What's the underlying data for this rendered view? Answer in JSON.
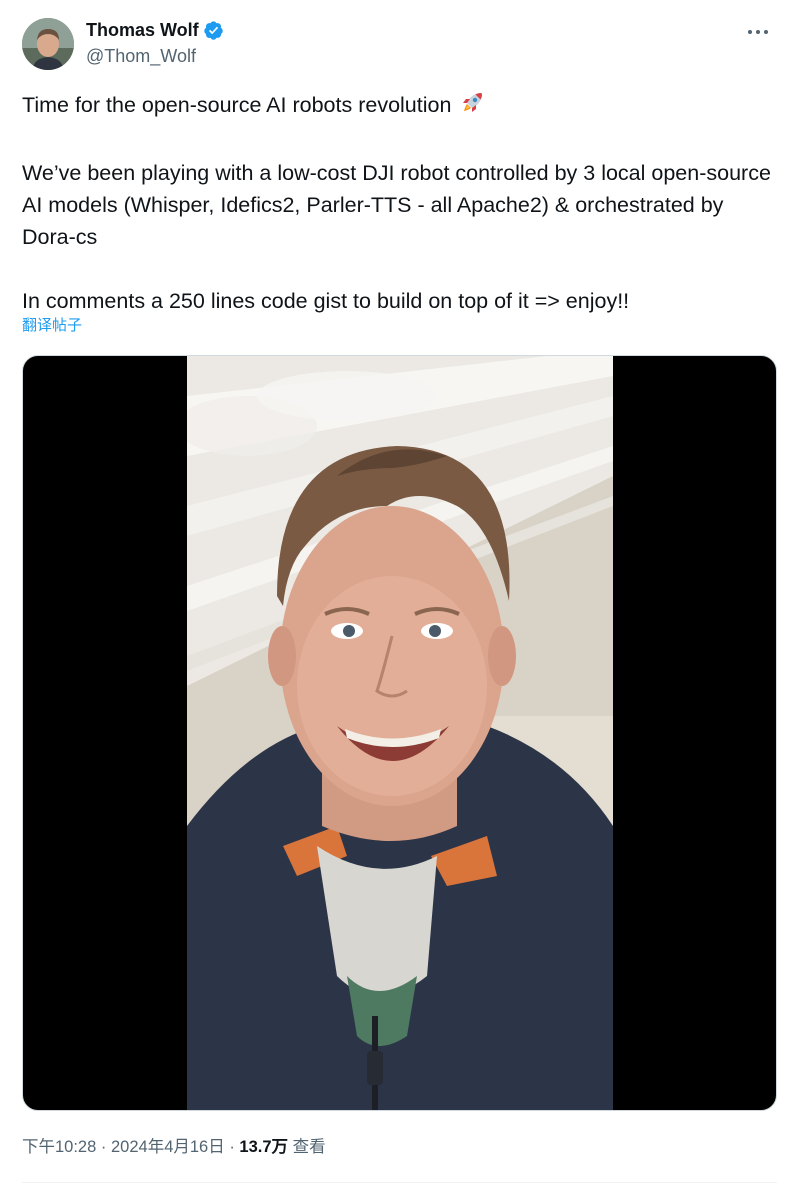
{
  "author": {
    "display_name": "Thomas Wolf",
    "handle": "@Thom_Wolf",
    "verified": true
  },
  "tweet": {
    "paragraphs": [
      "Time for the open-source AI robots revolution",
      "We’ve been playing with a low-cost DJI robot controlled by 3 local open-source AI models (Whisper, Idefics2, Parler-TTS - all Apache2) & orchestrated by Dora-cs",
      "In comments a 250 lines code gist to build on top of it => enjoy!!"
    ],
    "emoji": "🚀",
    "translate_label": "翻译帖子"
  },
  "footer": {
    "time": "下午10:28",
    "separator": "·",
    "date": "2024年4月16日",
    "views_count": "13.7万",
    "views_label": "查看"
  },
  "colors": {
    "accent": "#1d9bf0",
    "secondary_text": "#536471",
    "primary_text": "#0f1419",
    "verified_badge": "#1d9bf0"
  },
  "icons": {
    "verified": "verified-badge-icon",
    "more": "more-horizontal-icon",
    "rocket": "rocket-emoji-icon"
  }
}
